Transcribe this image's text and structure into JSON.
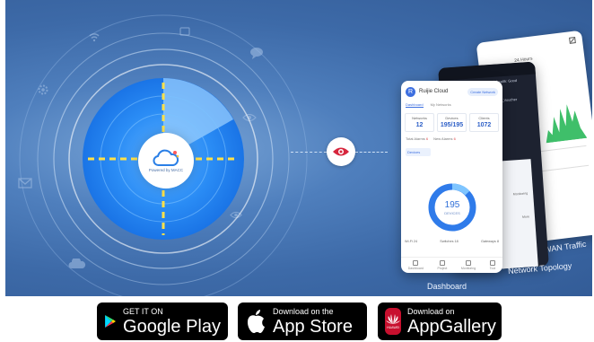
{
  "banner": {
    "logo_caption": "Powered by MACC",
    "screens": {
      "dashboard": {
        "caption": "Dashboard",
        "app_title": "Ruijie Cloud",
        "pill": "Create Network",
        "tabs": [
          "Dashboard",
          "My Networks"
        ],
        "stats": [
          {
            "label": "Networks",
            "value": "12"
          },
          {
            "label": "Devices",
            "value": "195/195"
          },
          {
            "label": "Clients",
            "value": "1072"
          }
        ],
        "alarms": [
          {
            "label": "Total Alarms",
            "value": "6"
          },
          {
            "label": "New Alarms",
            "value": "6"
          }
        ],
        "chip": "Devices",
        "donut_value": "195",
        "donut_label": "DEVICES",
        "legend": [
          "Wi-Fi 24",
          "Switches 18",
          "Gateways 8"
        ],
        "nav": [
          "Dashboard",
          "Project",
          "Monitoring",
          "Tool"
        ]
      },
      "topology": {
        "caption": "Network Topology",
        "rows": [
          "Network health: Good",
          "@Cloud_Voucher"
        ],
        "bottom_labels": [
          "Monitoring",
          "More"
        ]
      },
      "wan": {
        "caption": "WAN Traffic",
        "header": "24 Hours"
      }
    }
  },
  "badges": {
    "google_play": {
      "small": "GET IT ON",
      "big": "Google Play"
    },
    "app_store": {
      "small": "Download on the",
      "big": "App Store"
    },
    "app_gallery": {
      "small": "Download on",
      "big": "AppGallery",
      "logo_text": "HUAWEI"
    }
  },
  "colors": {
    "banner_blue": "#4f7fbd",
    "radar_blue": "#1f7ff0",
    "accent_red": "#d7263d",
    "dashed_yellow": "#ffe14a"
  }
}
